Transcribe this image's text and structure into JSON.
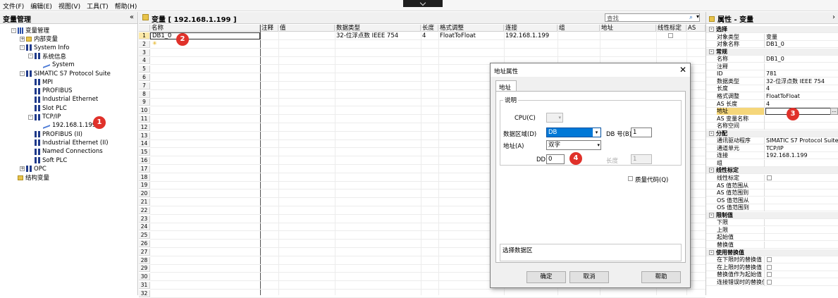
{
  "menu": [
    "文件(F)",
    "编辑(E)",
    "视图(V)",
    "工具(T)",
    "帮助(H)"
  ],
  "left_panel": {
    "title": "变量管理",
    "collapse": "«",
    "tree": [
      {
        "label": "变量管理",
        "level": 0,
        "icon": "db-icon",
        "exp": "-"
      },
      {
        "label": "内部变量",
        "level": 1,
        "icon": "folder-icon",
        "exp": "+"
      },
      {
        "label": "System Info",
        "level": 1,
        "icon": "channel-icon",
        "exp": "-"
      },
      {
        "label": "系统信息",
        "level": 2,
        "icon": "channel-icon",
        "exp": "-"
      },
      {
        "label": "System",
        "level": 3,
        "icon": "connection-icon",
        "exp": ""
      },
      {
        "label": "SIMATIC S7 Protocol Suite",
        "level": 1,
        "icon": "channel-icon",
        "exp": "-"
      },
      {
        "label": "MPI",
        "level": 2,
        "icon": "channel-icon",
        "exp": ""
      },
      {
        "label": "PROFIBUS",
        "level": 2,
        "icon": "channel-icon",
        "exp": ""
      },
      {
        "label": "Industrial Ethernet",
        "level": 2,
        "icon": "channel-icon",
        "exp": ""
      },
      {
        "label": "Slot PLC",
        "level": 2,
        "icon": "channel-icon",
        "exp": ""
      },
      {
        "label": "TCP/IP",
        "level": 2,
        "icon": "channel-icon",
        "exp": "-"
      },
      {
        "label": "192.168.1.199",
        "level": 3,
        "icon": "connection-icon",
        "exp": ""
      },
      {
        "label": "PROFIBUS (II)",
        "level": 2,
        "icon": "channel-icon",
        "exp": ""
      },
      {
        "label": "Industrial Ethernet (II)",
        "level": 2,
        "icon": "channel-icon",
        "exp": ""
      },
      {
        "label": "Named Connections",
        "level": 2,
        "icon": "channel-icon",
        "exp": ""
      },
      {
        "label": "Soft PLC",
        "level": 2,
        "icon": "channel-icon",
        "exp": ""
      },
      {
        "label": "OPC",
        "level": 1,
        "icon": "channel-icon",
        "exp": "+"
      },
      {
        "label": "结构变量",
        "level": 0,
        "icon": "struct-icon",
        "exp": ""
      }
    ]
  },
  "center": {
    "title": "变量 [ 192.168.1.199 ]",
    "search_placeholder": "查找",
    "columns": [
      "名称",
      "注释",
      "值",
      "数据类型",
      "长度",
      "格式调整",
      "连接",
      "组",
      "地址",
      "线性标定",
      "AS"
    ],
    "rows": [
      {
        "num": "1",
        "name": "DB1_0",
        "type": "32-位浮点数 IEEE 754",
        "length": "4",
        "format": "FloatToFloat",
        "connection": "192.168.1.199"
      },
      {
        "num": "2",
        "name": "",
        "type": "",
        "length": "",
        "format": "",
        "connection": ""
      }
    ],
    "row_count_labels": [
      "1",
      "2",
      "3",
      "4",
      "5",
      "6",
      "7",
      "8",
      "9",
      "10",
      "11",
      "12",
      "13",
      "14",
      "15",
      "16",
      "17",
      "18",
      "19",
      "20",
      "21",
      "22",
      "23",
      "24",
      "25",
      "26",
      "27",
      "28",
      "29",
      "30",
      "31",
      "32"
    ]
  },
  "right_panel": {
    "title": "属性 - 变量",
    "rows": [
      {
        "cat": true,
        "k": "选择"
      },
      {
        "k": "对象类型",
        "v": "变量"
      },
      {
        "k": "对象名称",
        "v": "DB1_0"
      },
      {
        "cat": true,
        "k": "常规"
      },
      {
        "k": "名称",
        "v": "DB1_0"
      },
      {
        "k": "注释",
        "v": ""
      },
      {
        "k": "ID",
        "v": "781"
      },
      {
        "k": "数据类型",
        "v": "32-位浮点数 IEEE 754"
      },
      {
        "k": "长度",
        "v": "4"
      },
      {
        "k": "格式调整",
        "v": "FloatToFloat"
      },
      {
        "k": "AS 长度",
        "v": "4"
      },
      {
        "k": "地址",
        "v": "",
        "highlight": true
      },
      {
        "k": "AS 变量名称",
        "v": ""
      },
      {
        "k": "名称空间",
        "v": ""
      },
      {
        "cat": true,
        "k": "分配"
      },
      {
        "k": "通讯驱动程序",
        "v": "SIMATIC S7 Protocol Suite"
      },
      {
        "k": "通道单元",
        "v": "TCP/IP"
      },
      {
        "k": "连接",
        "v": "192.168.1.199"
      },
      {
        "k": "组",
        "v": ""
      },
      {
        "cat": true,
        "k": "线性标定"
      },
      {
        "k": "线性标定",
        "v": "",
        "chk": true
      },
      {
        "k": "AS 值范围从",
        "v": ""
      },
      {
        "k": "AS 值范围到",
        "v": ""
      },
      {
        "k": "OS 值范围从",
        "v": ""
      },
      {
        "k": "OS 值范围到",
        "v": ""
      },
      {
        "cat": true,
        "k": "限制值"
      },
      {
        "k": "下限",
        "v": ""
      },
      {
        "k": "上限",
        "v": ""
      },
      {
        "k": "起始值",
        "v": ""
      },
      {
        "k": "替换值",
        "v": ""
      },
      {
        "cat": true,
        "k": "使用替换值"
      },
      {
        "k": "在下限时的替换值",
        "v": "",
        "chk": true
      },
      {
        "k": "在上限时的替换值",
        "v": "",
        "chk": true
      },
      {
        "k": "替换值作为起始值",
        "v": "",
        "chk": true
      },
      {
        "k": "连接错误时的替换值",
        "v": "",
        "chk": true
      }
    ],
    "ellipsis": "..."
  },
  "dialog": {
    "title": "地址属性",
    "close": "✕",
    "tab": "地址",
    "group": "说明",
    "cpu_label": "CPU(C)",
    "area_label": "数据区域(D)",
    "area_value": "DB",
    "db_label": "DB 号(B)",
    "db_value": "1",
    "addr_label": "地址(A)",
    "addr_value": "双字",
    "dd_label": "DD",
    "dd_value": "0",
    "len_label": "长度",
    "len_value": "1",
    "quality_label": "质量代码(Q)",
    "desc": "选择数据区",
    "ok": "确定",
    "cancel": "取消",
    "help": "帮助"
  },
  "badges": [
    "1",
    "2",
    "3",
    "4"
  ]
}
